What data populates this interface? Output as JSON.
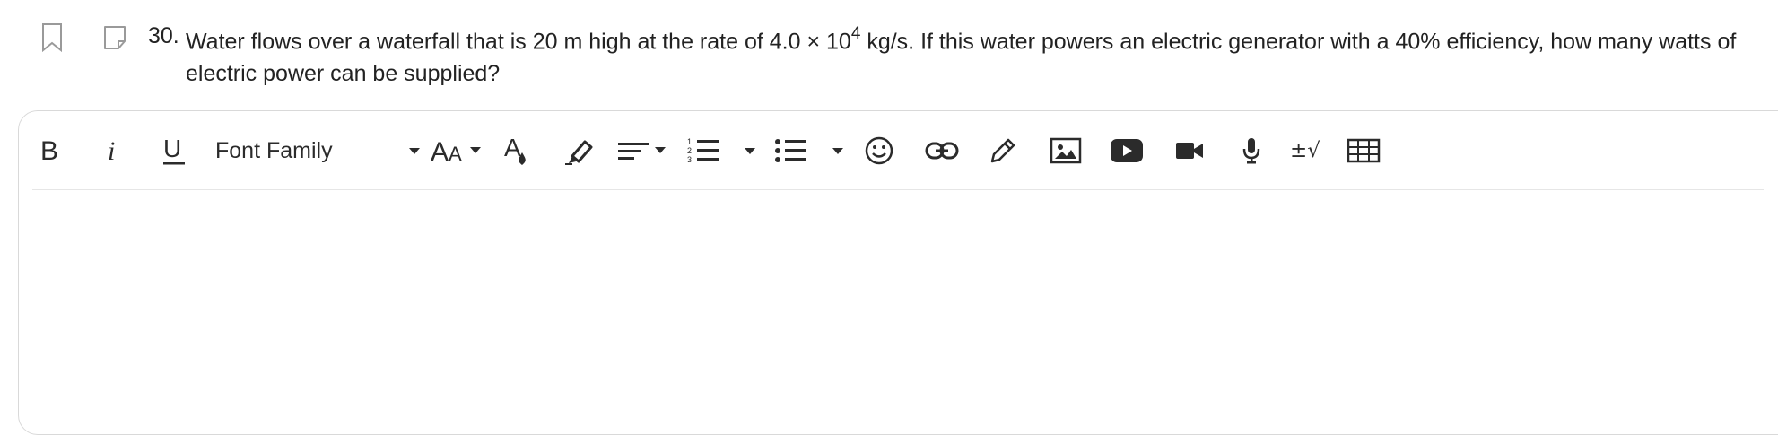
{
  "question": {
    "number": "30.",
    "text_before": "Water flows over a waterfall that is 20 m high at the rate of 4.0 × 10",
    "superscript": "4",
    "text_after": " kg/s. If this water powers an electric generator with a 40% efficiency, how many watts of electric power can be supplied?",
    "bookmark_icon": "bookmark-icon",
    "note_icon": "note-icon"
  },
  "toolbar": {
    "font_family_label": "Font Family",
    "math_label": "±√",
    "icons": [
      "bold-icon",
      "italic-icon",
      "underline-icon",
      "chevron-down-icon",
      "font-size-icon",
      "text-color-icon",
      "highlight-icon",
      "align-icon",
      "numbered-list-icon",
      "bullet-list-icon",
      "emoji-icon",
      "link-icon",
      "pen-icon",
      "image-icon",
      "youtube-icon",
      "video-icon",
      "microphone-icon",
      "math-icon",
      "table-icon"
    ]
  },
  "editor": {
    "content": ""
  },
  "colors": {
    "text": "#222222",
    "icon": "#2b2b2b",
    "border": "#d9d9d9",
    "muted_icon": "#9a9a9a"
  }
}
